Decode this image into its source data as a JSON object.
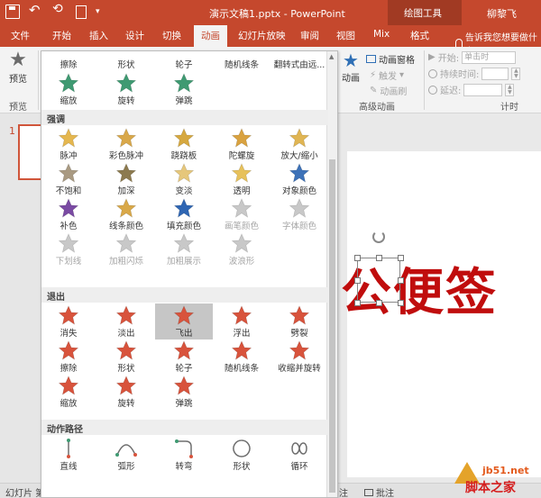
{
  "titlebar": {
    "doc_title": "演示文稿1.pptx - PowerPoint",
    "context_group": "绘图工具",
    "user": "柳黎飞",
    "qat_more": "▾"
  },
  "tabs": {
    "file": "文件",
    "home": "开始",
    "insert": "插入",
    "design": "设计",
    "transitions": "切换",
    "animations": "动画",
    "slideshow": "幻灯片放映",
    "review": "审阅",
    "view": "视图",
    "mix": "Mix",
    "format": "格式",
    "tell_me": "告诉我您想要做什么..."
  },
  "ribbon": {
    "preview_label": "预览",
    "preview_group": "预览",
    "animations_btn": "动画",
    "animation_pane": "动画窗格",
    "trigger": "触发",
    "painter": "动画刷",
    "advanced_group": "高级动画",
    "start_label": "开始:",
    "start_value": "单击时",
    "duration_label": "持续时间:",
    "delay_label": "延迟:",
    "timing_group": "计时"
  },
  "slide": {
    "number": "1",
    "text": "公便签"
  },
  "statusbar": {
    "slide_info": "幻灯片 第",
    "notes": "注",
    "comments": "批注"
  },
  "watermark": {
    "site": "jb51.net",
    "name": "脚本之家"
  },
  "gallery": {
    "top_row": [
      "擦除",
      "形状",
      "轮子",
      "随机线条",
      "翻转式由远..."
    ],
    "entrance_partial": [
      {
        "label": "缩放"
      },
      {
        "label": "旋转"
      },
      {
        "label": "弹跳"
      }
    ],
    "emphasis_header": "强调",
    "emphasis": [
      {
        "label": "脉冲",
        "disabled": false
      },
      {
        "label": "彩色脉冲",
        "disabled": false
      },
      {
        "label": "跷跷板",
        "disabled": false
      },
      {
        "label": "陀螺旋",
        "disabled": false
      },
      {
        "label": "放大/缩小",
        "disabled": false
      },
      {
        "label": "不饱和",
        "disabled": false
      },
      {
        "label": "加深",
        "disabled": false
      },
      {
        "label": "变淡",
        "disabled": false
      },
      {
        "label": "透明",
        "disabled": false
      },
      {
        "label": "对象颜色",
        "disabled": false
      },
      {
        "label": "补色",
        "disabled": false
      },
      {
        "label": "线条颜色",
        "disabled": false
      },
      {
        "label": "填充颜色",
        "disabled": false
      },
      {
        "label": "画笔颜色",
        "disabled": true
      },
      {
        "label": "字体颜色",
        "disabled": true
      },
      {
        "label": "下划线",
        "disabled": true
      },
      {
        "label": "加粗闪烁",
        "disabled": true
      },
      {
        "label": "加粗展示",
        "disabled": true
      },
      {
        "label": "波浪形",
        "disabled": true
      }
    ],
    "exit_header": "退出",
    "exit": [
      {
        "label": "消失"
      },
      {
        "label": "淡出"
      },
      {
        "label": "飞出"
      },
      {
        "label": "浮出"
      },
      {
        "label": "劈裂"
      },
      {
        "label": "擦除"
      },
      {
        "label": "形状"
      },
      {
        "label": "轮子"
      },
      {
        "label": "随机线条"
      },
      {
        "label": "收缩并旋转"
      },
      {
        "label": "缩放"
      },
      {
        "label": "旋转"
      },
      {
        "label": "弹跳"
      }
    ],
    "motion_header": "动作路径",
    "motion": [
      {
        "label": "直线"
      },
      {
        "label": "弧形"
      },
      {
        "label": "转弯"
      },
      {
        "label": "形状"
      },
      {
        "label": "循环"
      }
    ],
    "colors": {
      "entrance": "#3f9a72",
      "emphasis_gold": "#e0b553",
      "exit": "#d8533c",
      "disabled": "#c8c8c8"
    }
  }
}
